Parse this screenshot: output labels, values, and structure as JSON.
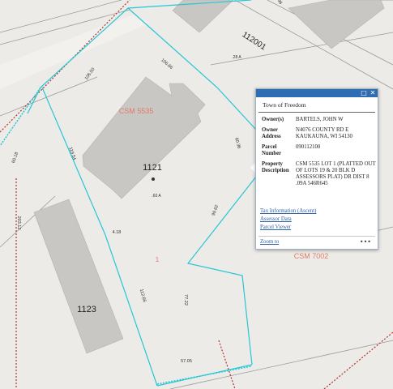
{
  "map": {
    "parcel_ids": {
      "p1121": "1121",
      "p1123": "1123",
      "p112001": "112001"
    },
    "csm_labels": {
      "csm5535": "CSM 5535",
      "csm7002": "CSM 7002"
    },
    "lot_label": "1",
    "acreage": ".60 A",
    "small_acreage": ".28 A",
    "dimensions": {
      "d10650": "106.50",
      "d10666": "106.66",
      "d11954": "119.54",
      "d6036": "60.36",
      "d9962": "99.62",
      "d418": "4.18",
      "d11266": "112.66",
      "d7722": "77.22",
      "d5705": "57.05",
      "d6018": "60.18",
      "d20312": "203.12",
      "d96": "96"
    },
    "colors": {
      "background": "#ecebe8",
      "parcel_line": "#26c7d4",
      "building": "#c9c7c3",
      "csm_text": "#e07b6a",
      "boundary": "#b0342a"
    }
  },
  "popup": {
    "title": "Town of Freedom",
    "fields": [
      {
        "key": "Owner(s)",
        "value": "BARTELS, JOHN W"
      },
      {
        "key": "Owner Address",
        "value": "N4076 COUNTY RD E KAUKAUNA, WI 54130"
      },
      {
        "key": "Parcel Number",
        "value": "090112100"
      },
      {
        "key": "Property Description",
        "value": "CSM 5535 LOT 1 (PLATTED OUT OF LOTS 19 & 20 BLK D ASSESSORS PLAT) DR DIST 8 .09A 546R645"
      }
    ],
    "links": [
      "Tax Information (Ascent)",
      "Assessor Data",
      "Parcel Viewer"
    ],
    "zoom_to": "Zoom to",
    "more": "•••",
    "icons": {
      "maximize": "maximize-icon",
      "close": "close-icon"
    }
  }
}
